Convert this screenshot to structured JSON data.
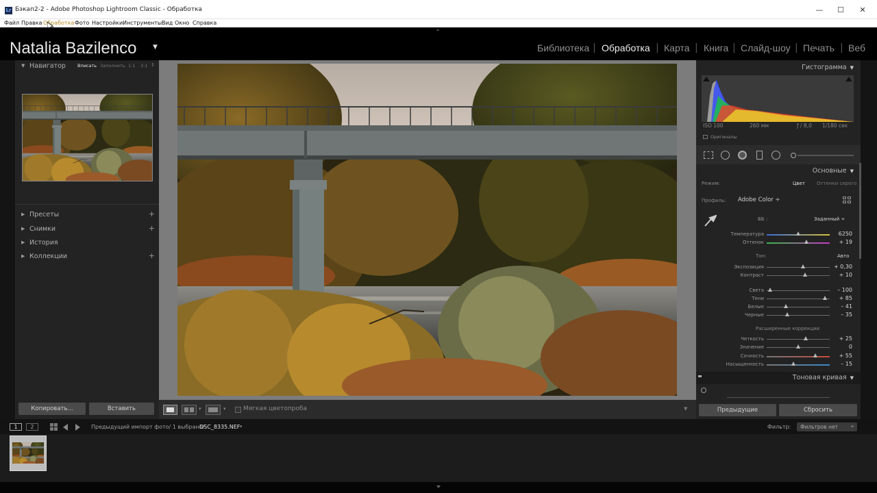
{
  "window": {
    "title": "Бэкап2-2 - Adobe Photoshop Lightroom Classic - Обработка",
    "app_icon": "Lr",
    "controls": [
      "—",
      "☐",
      "✕"
    ]
  },
  "menu": [
    "Файл",
    "Правка",
    "Обработка",
    "Фото",
    "Настройки",
    "Инструменты",
    "Вид",
    "Окно",
    "Справка"
  ],
  "identity": {
    "name": "Natalia Bazilenco",
    "caret": "▼"
  },
  "modules": [
    "Библиотека",
    "Обработка",
    "Карта",
    "Книга",
    "Слайд-шоу",
    "Печать",
    "Веб"
  ],
  "active_module": "Обработка",
  "left_panel": {
    "navigator": {
      "title": "Навигатор",
      "zoom": [
        "Вписать",
        "Заполнить",
        "1:1",
        "3:1"
      ],
      "zoom_caret": "⇕"
    },
    "sections": [
      {
        "label": "Пресеты",
        "plus": "+"
      },
      {
        "label": "Снимки",
        "plus": "+"
      },
      {
        "label": "История",
        "plus": ""
      },
      {
        "label": "Коллекции",
        "plus": "+"
      }
    ],
    "copy_button": "Копировать...",
    "paste_button": "Вставить"
  },
  "toolbar": {
    "soft_proof_label": "Мягкая цветопроба"
  },
  "right_panel": {
    "histogram": {
      "title": "Гистограмма",
      "iso": "ISO 100",
      "focal": "260 мм",
      "aperture": "ƒ / 8,0",
      "shutter": "1/180 сек",
      "originals": "Оригиналы"
    },
    "basic": {
      "title": "Основные",
      "mode_label": "Режим:",
      "mode_color": "Цвет",
      "mode_bw": "Оттенки серого",
      "profile_label": "Профиль:",
      "profile_value": "Adobe Color ÷",
      "wb_label": "ББ :",
      "wb_value": "Заданный ÷",
      "tone_label": "Тон:",
      "auto_label": "Авто",
      "presence_label": "Расширенные коррекции",
      "sliders": [
        {
          "label": "Температура",
          "value": "6250",
          "pos": 0.5,
          "group": "wb"
        },
        {
          "label": "Оттенок",
          "value": "+ 19",
          "pos": 0.63,
          "group": "wb"
        },
        {
          "label": "Экспозиция",
          "value": "+ 0,30",
          "pos": 0.58,
          "group": "tone"
        },
        {
          "label": "Контраст",
          "value": "+ 10",
          "pos": 0.61,
          "group": "tone"
        },
        {
          "label": "Света",
          "value": "– 100",
          "pos": 0.05,
          "group": "tone2"
        },
        {
          "label": "Тени",
          "value": "+ 85",
          "pos": 0.92,
          "group": "tone2"
        },
        {
          "label": "Белые",
          "value": "– 41",
          "pos": 0.3,
          "group": "tone2"
        },
        {
          "label": "Черные",
          "value": "– 35",
          "pos": 0.33,
          "group": "tone2"
        },
        {
          "label": "Четкость",
          "value": "+ 25",
          "pos": 0.62,
          "group": "presence"
        },
        {
          "label": "Значение",
          "value": "0",
          "pos": 0.5,
          "group": "presence"
        },
        {
          "label": "Сочность",
          "value": "+ 55",
          "pos": 0.77,
          "group": "presence"
        },
        {
          "label": "Насыщенность",
          "value": "– 15",
          "pos": 0.42,
          "group": "presence"
        }
      ]
    },
    "tone_curve": {
      "title": "Тоновая кривая"
    },
    "prev_button": "Предыдущие",
    "reset_button": "Сбросить"
  },
  "filmstrip": {
    "page1": "1",
    "page2": "2",
    "path": "Предыдущий импорт фото/ 1 выбрано/",
    "filename": "DSC_8335.NEF",
    "filter_label": "Фильтр:",
    "filter_value": "Фильтров нет"
  }
}
